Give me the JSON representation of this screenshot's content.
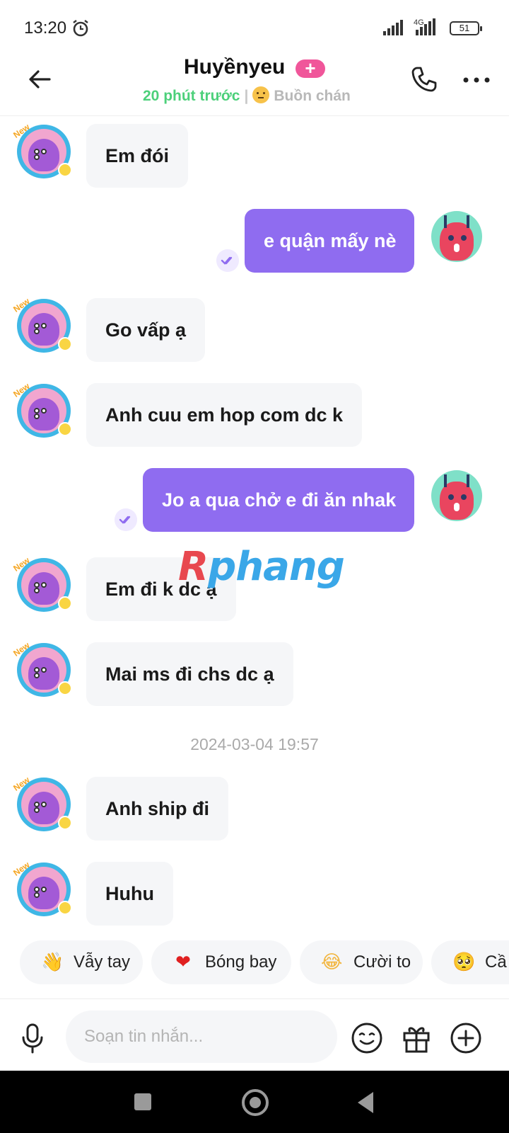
{
  "status_bar": {
    "time": "13:20",
    "network": "4G",
    "battery": "51"
  },
  "header": {
    "contact_name": "Huyềnyeu",
    "add_badge": "+",
    "last_seen": "20 phút trước",
    "separator": "|",
    "mood": "Buồn chán"
  },
  "messages": [
    {
      "dir": "in",
      "text": "Em đói"
    },
    {
      "dir": "out",
      "text": "e quận mấy nè"
    },
    {
      "dir": "in",
      "text": "Go vấp ạ"
    },
    {
      "dir": "in",
      "text": "Anh cuu em hop com dc k"
    },
    {
      "dir": "out",
      "text": "Jo a qua chở e đi ăn nhak"
    },
    {
      "dir": "in",
      "text": "Em đi k dc ạ"
    },
    {
      "dir": "in",
      "text": "Mai ms đi chs dc ạ"
    },
    {
      "dir": "in",
      "text": "Anh ship đi"
    },
    {
      "dir": "in",
      "text": "Huhu"
    }
  ],
  "timestamp": "2024-03-04 19:57",
  "avatar_badge": "New",
  "watermark": {
    "part1": "R",
    "part2": "phang"
  },
  "quick_reactions": [
    {
      "emoji": "👋",
      "label": "Vẫy tay"
    },
    {
      "emoji": "❤",
      "label": "Bóng bay"
    },
    {
      "emoji": "😂",
      "label": "Cười to"
    },
    {
      "emoji": "🥺",
      "label": "Cầ"
    }
  ],
  "input": {
    "placeholder": "Soạn tin nhắn..."
  },
  "colors": {
    "outgoing_bubble": "#8f6cf0",
    "incoming_bubble": "#f5f6f8",
    "online_green": "#4cd07a",
    "badge_pink": "#f0569a"
  }
}
